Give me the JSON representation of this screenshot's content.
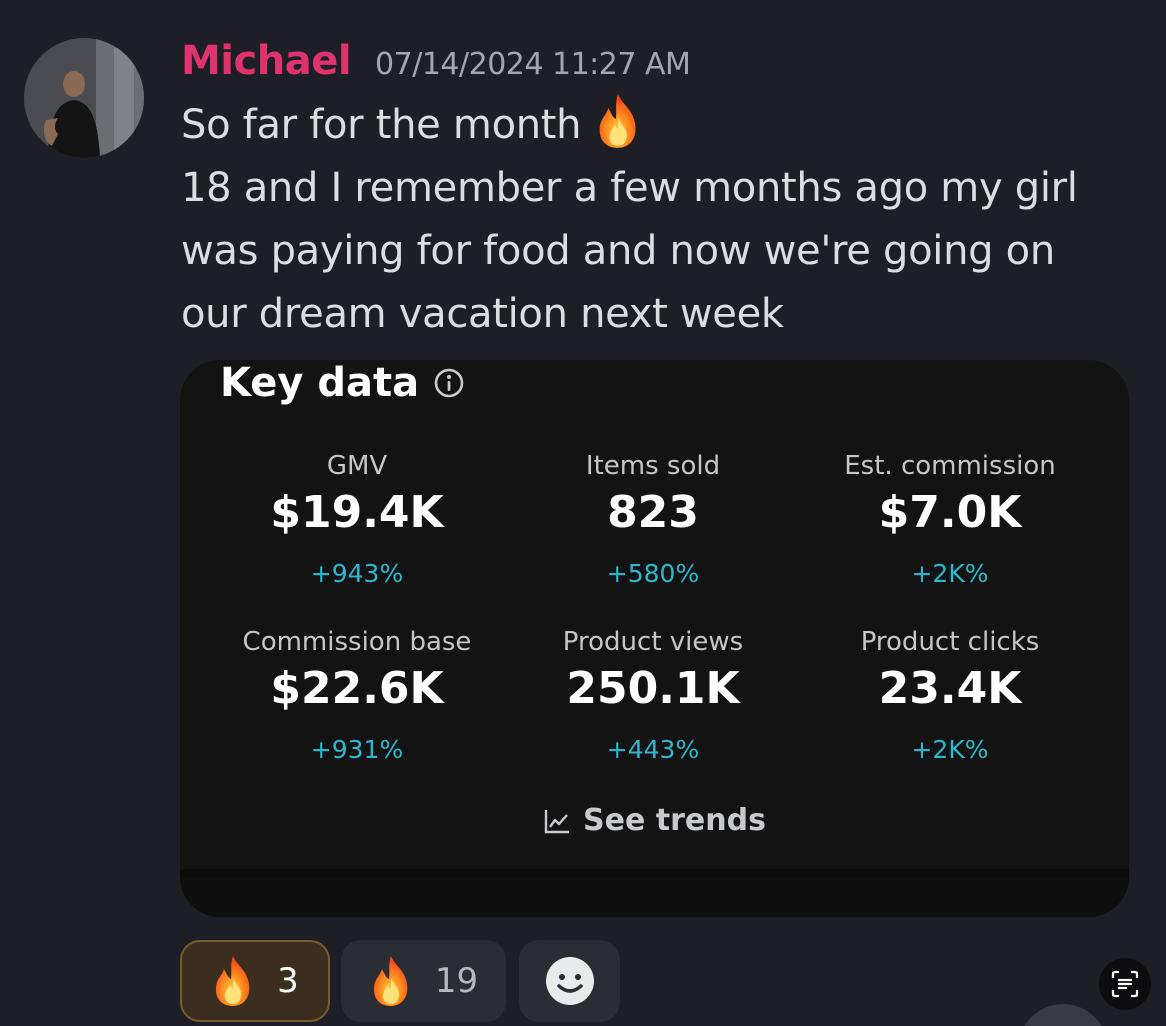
{
  "message": {
    "username": "Michael",
    "timestamp": "07/14/2024 11:27 AM",
    "lines": [
      "So far for the month",
      "18 and I remember a few months ago my girl",
      "was paying for food and now we're going on",
      "our dream vacation next week"
    ],
    "inline_emoji": "fire-icon"
  },
  "embed": {
    "title": "Key data",
    "metrics": [
      {
        "label": "GMV",
        "value": "$19.4K",
        "change": "+943%"
      },
      {
        "label": "Items sold",
        "value": "823",
        "change": "+580%"
      },
      {
        "label": "Est. commission",
        "value": "$7.0K",
        "change": "+2K%"
      },
      {
        "label": "Commission base",
        "value": "$22.6K",
        "change": "+931%"
      },
      {
        "label": "Product views",
        "value": "250.1K",
        "change": "+443%"
      },
      {
        "label": "Product clicks",
        "value": "23.4K",
        "change": "+2K%"
      }
    ],
    "see_trends": "See trends"
  },
  "reactions": [
    {
      "emoji": "fire-icon",
      "count": "3",
      "active": true
    },
    {
      "emoji": "fire-icon",
      "count": "19",
      "active": false
    }
  ],
  "colors": {
    "background": "#1e1f26",
    "username": "#e0336e",
    "embed_background": "#131313",
    "positive_change": "#2bb8cf",
    "active_reaction_border": "#7b5a2c"
  }
}
